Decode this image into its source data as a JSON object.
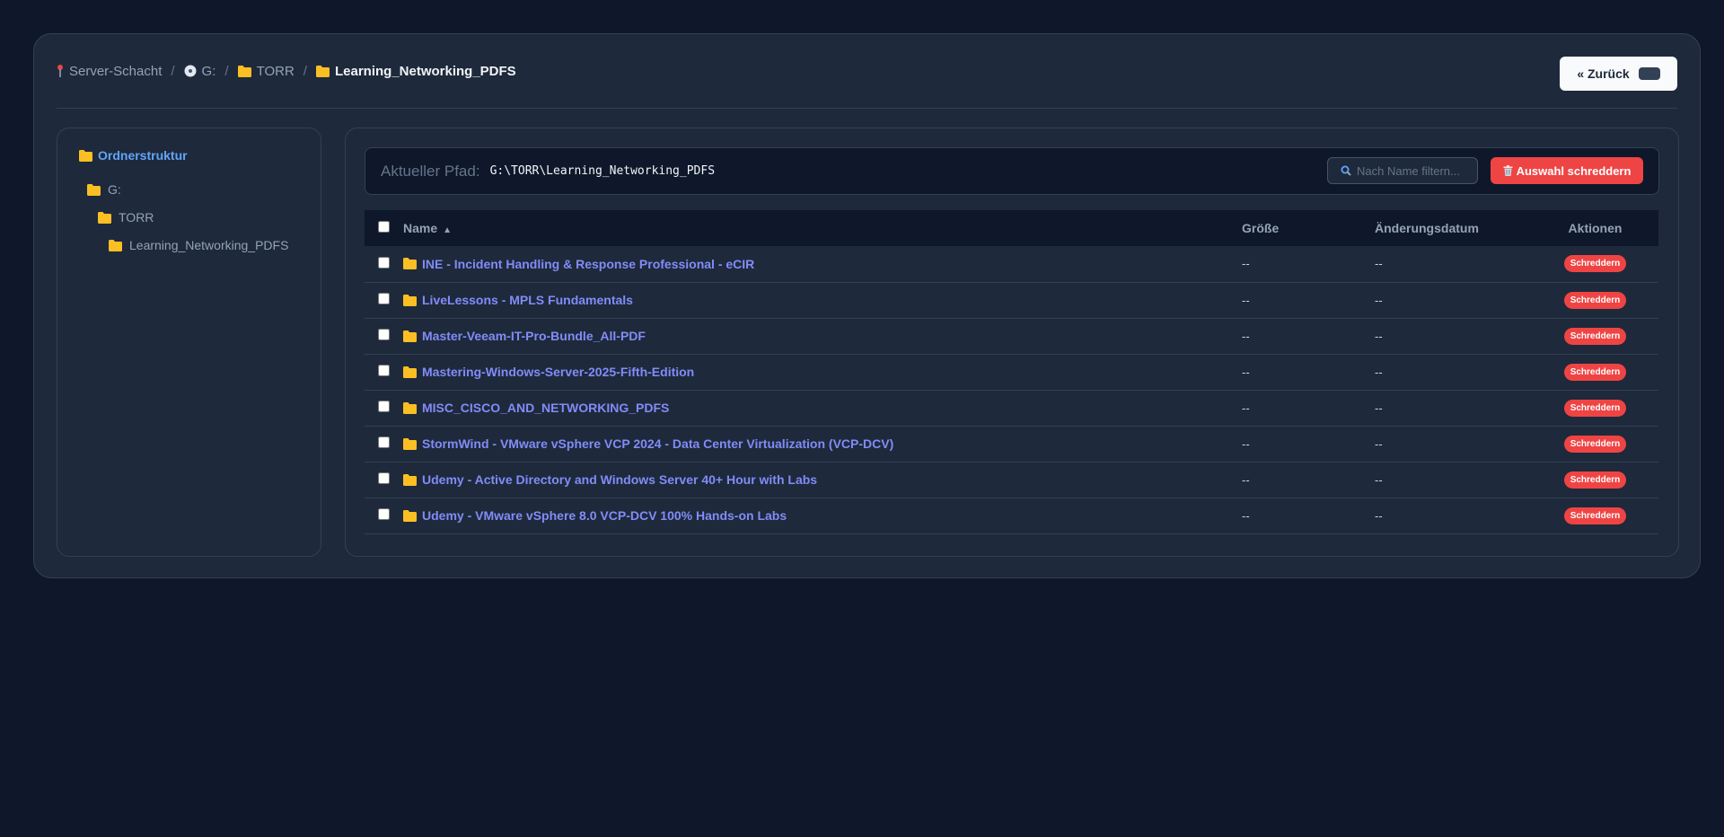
{
  "breadcrumb": [
    {
      "icon": "pin-icon",
      "label": "Server-Schacht"
    },
    {
      "icon": "disc-icon",
      "label": "G:"
    },
    {
      "icon": "folder-icon",
      "label": "TORR"
    },
    {
      "icon": "folder-icon",
      "label": "Learning_Networking_PDFS"
    }
  ],
  "back_button": {
    "label": "« Zurück"
  },
  "tree": {
    "title": "Ordnerstruktur",
    "items": [
      {
        "label": "G:",
        "level": 0
      },
      {
        "label": "TORR",
        "level": 1
      },
      {
        "label": "Learning_Networking_PDFS",
        "level": 2
      }
    ]
  },
  "pathbar": {
    "label": "Aktueller Pfad:",
    "value": "G:\\TORR\\Learning_Networking_PDFS",
    "filter_placeholder": "Nach Name filtern...",
    "shred_selection_label": "Auswahl schreddern"
  },
  "table": {
    "headers": {
      "name": "Name",
      "sort_indicator": "▲",
      "size": "Größe",
      "date": "Änderungsdatum",
      "actions": "Aktionen"
    },
    "action_label": "Schreddern",
    "rows": [
      {
        "name": "INE - Incident Handling & Response Professional - eCIR",
        "size": "--",
        "date": "--"
      },
      {
        "name": "LiveLessons - MPLS Fundamentals",
        "size": "--",
        "date": "--"
      },
      {
        "name": "Master-Veeam-IT-Pro-Bundle_All-PDF",
        "size": "--",
        "date": "--"
      },
      {
        "name": "Mastering-Windows-Server-2025-Fifth-Edition",
        "size": "--",
        "date": "--"
      },
      {
        "name": "MISC_CISCO_AND_NETWORKING_PDFS",
        "size": "--",
        "date": "--"
      },
      {
        "name": "StormWind - VMware vSphere VCP 2024 - Data Center Virtualization (VCP-DCV)",
        "size": "--",
        "date": "--"
      },
      {
        "name": "Udemy - Active Directory and Windows Server 40+ Hour with Labs",
        "size": "--",
        "date": "--"
      },
      {
        "name": "Udemy - VMware vSphere 8.0 VCP-DCV 100% Hands-on Labs",
        "size": "--",
        "date": "--"
      }
    ]
  },
  "colors": {
    "background": "#0f172a",
    "panel": "#1e293b",
    "accent": "#60a5fa",
    "link": "#818cf8",
    "danger": "#ef4444",
    "folder": "#fbbf24"
  }
}
